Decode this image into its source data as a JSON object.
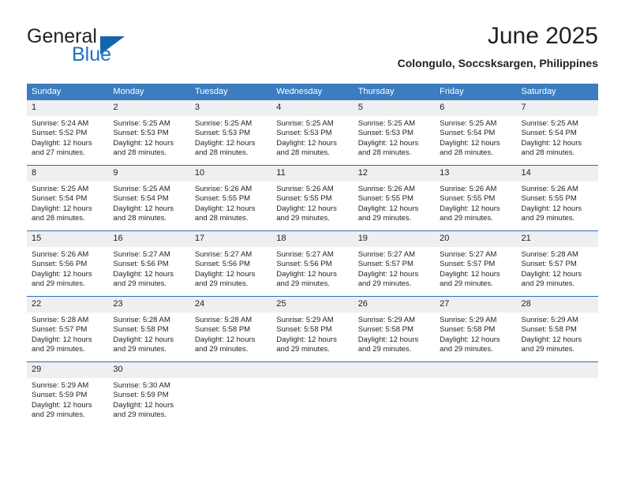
{
  "logo": {
    "word_one": "General",
    "word_two": "Blue",
    "triangle_color": "#1565ad",
    "blue_text_color": "#1e73be"
  },
  "header": {
    "title": "June 2025",
    "subtitle": "Colongulo, Soccsksargen, Philippines"
  },
  "theme": {
    "header_bg": "#3b7dc0",
    "header_text": "#ffffff",
    "daynum_bg": "#efefef",
    "row_border": "#2a6fb5",
    "body_text": "#231f20"
  },
  "weekday_headers": [
    "Sunday",
    "Monday",
    "Tuesday",
    "Wednesday",
    "Thursday",
    "Friday",
    "Saturday"
  ],
  "weeks": [
    [
      {
        "day": "1",
        "sunrise": "Sunrise: 5:24 AM",
        "sunset": "Sunset: 5:52 PM",
        "daylight_line1": "Daylight: 12 hours",
        "daylight_line2": "and 27 minutes."
      },
      {
        "day": "2",
        "sunrise": "Sunrise: 5:25 AM",
        "sunset": "Sunset: 5:53 PM",
        "daylight_line1": "Daylight: 12 hours",
        "daylight_line2": "and 28 minutes."
      },
      {
        "day": "3",
        "sunrise": "Sunrise: 5:25 AM",
        "sunset": "Sunset: 5:53 PM",
        "daylight_line1": "Daylight: 12 hours",
        "daylight_line2": "and 28 minutes."
      },
      {
        "day": "4",
        "sunrise": "Sunrise: 5:25 AM",
        "sunset": "Sunset: 5:53 PM",
        "daylight_line1": "Daylight: 12 hours",
        "daylight_line2": "and 28 minutes."
      },
      {
        "day": "5",
        "sunrise": "Sunrise: 5:25 AM",
        "sunset": "Sunset: 5:53 PM",
        "daylight_line1": "Daylight: 12 hours",
        "daylight_line2": "and 28 minutes."
      },
      {
        "day": "6",
        "sunrise": "Sunrise: 5:25 AM",
        "sunset": "Sunset: 5:54 PM",
        "daylight_line1": "Daylight: 12 hours",
        "daylight_line2": "and 28 minutes."
      },
      {
        "day": "7",
        "sunrise": "Sunrise: 5:25 AM",
        "sunset": "Sunset: 5:54 PM",
        "daylight_line1": "Daylight: 12 hours",
        "daylight_line2": "and 28 minutes."
      }
    ],
    [
      {
        "day": "8",
        "sunrise": "Sunrise: 5:25 AM",
        "sunset": "Sunset: 5:54 PM",
        "daylight_line1": "Daylight: 12 hours",
        "daylight_line2": "and 28 minutes."
      },
      {
        "day": "9",
        "sunrise": "Sunrise: 5:25 AM",
        "sunset": "Sunset: 5:54 PM",
        "daylight_line1": "Daylight: 12 hours",
        "daylight_line2": "and 28 minutes."
      },
      {
        "day": "10",
        "sunrise": "Sunrise: 5:26 AM",
        "sunset": "Sunset: 5:55 PM",
        "daylight_line1": "Daylight: 12 hours",
        "daylight_line2": "and 28 minutes."
      },
      {
        "day": "11",
        "sunrise": "Sunrise: 5:26 AM",
        "sunset": "Sunset: 5:55 PM",
        "daylight_line1": "Daylight: 12 hours",
        "daylight_line2": "and 29 minutes."
      },
      {
        "day": "12",
        "sunrise": "Sunrise: 5:26 AM",
        "sunset": "Sunset: 5:55 PM",
        "daylight_line1": "Daylight: 12 hours",
        "daylight_line2": "and 29 minutes."
      },
      {
        "day": "13",
        "sunrise": "Sunrise: 5:26 AM",
        "sunset": "Sunset: 5:55 PM",
        "daylight_line1": "Daylight: 12 hours",
        "daylight_line2": "and 29 minutes."
      },
      {
        "day": "14",
        "sunrise": "Sunrise: 5:26 AM",
        "sunset": "Sunset: 5:55 PM",
        "daylight_line1": "Daylight: 12 hours",
        "daylight_line2": "and 29 minutes."
      }
    ],
    [
      {
        "day": "15",
        "sunrise": "Sunrise: 5:26 AM",
        "sunset": "Sunset: 5:56 PM",
        "daylight_line1": "Daylight: 12 hours",
        "daylight_line2": "and 29 minutes."
      },
      {
        "day": "16",
        "sunrise": "Sunrise: 5:27 AM",
        "sunset": "Sunset: 5:56 PM",
        "daylight_line1": "Daylight: 12 hours",
        "daylight_line2": "and 29 minutes."
      },
      {
        "day": "17",
        "sunrise": "Sunrise: 5:27 AM",
        "sunset": "Sunset: 5:56 PM",
        "daylight_line1": "Daylight: 12 hours",
        "daylight_line2": "and 29 minutes."
      },
      {
        "day": "18",
        "sunrise": "Sunrise: 5:27 AM",
        "sunset": "Sunset: 5:56 PM",
        "daylight_line1": "Daylight: 12 hours",
        "daylight_line2": "and 29 minutes."
      },
      {
        "day": "19",
        "sunrise": "Sunrise: 5:27 AM",
        "sunset": "Sunset: 5:57 PM",
        "daylight_line1": "Daylight: 12 hours",
        "daylight_line2": "and 29 minutes."
      },
      {
        "day": "20",
        "sunrise": "Sunrise: 5:27 AM",
        "sunset": "Sunset: 5:57 PM",
        "daylight_line1": "Daylight: 12 hours",
        "daylight_line2": "and 29 minutes."
      },
      {
        "day": "21",
        "sunrise": "Sunrise: 5:28 AM",
        "sunset": "Sunset: 5:57 PM",
        "daylight_line1": "Daylight: 12 hours",
        "daylight_line2": "and 29 minutes."
      }
    ],
    [
      {
        "day": "22",
        "sunrise": "Sunrise: 5:28 AM",
        "sunset": "Sunset: 5:57 PM",
        "daylight_line1": "Daylight: 12 hours",
        "daylight_line2": "and 29 minutes."
      },
      {
        "day": "23",
        "sunrise": "Sunrise: 5:28 AM",
        "sunset": "Sunset: 5:58 PM",
        "daylight_line1": "Daylight: 12 hours",
        "daylight_line2": "and 29 minutes."
      },
      {
        "day": "24",
        "sunrise": "Sunrise: 5:28 AM",
        "sunset": "Sunset: 5:58 PM",
        "daylight_line1": "Daylight: 12 hours",
        "daylight_line2": "and 29 minutes."
      },
      {
        "day": "25",
        "sunrise": "Sunrise: 5:29 AM",
        "sunset": "Sunset: 5:58 PM",
        "daylight_line1": "Daylight: 12 hours",
        "daylight_line2": "and 29 minutes."
      },
      {
        "day": "26",
        "sunrise": "Sunrise: 5:29 AM",
        "sunset": "Sunset: 5:58 PM",
        "daylight_line1": "Daylight: 12 hours",
        "daylight_line2": "and 29 minutes."
      },
      {
        "day": "27",
        "sunrise": "Sunrise: 5:29 AM",
        "sunset": "Sunset: 5:58 PM",
        "daylight_line1": "Daylight: 12 hours",
        "daylight_line2": "and 29 minutes."
      },
      {
        "day": "28",
        "sunrise": "Sunrise: 5:29 AM",
        "sunset": "Sunset: 5:58 PM",
        "daylight_line1": "Daylight: 12 hours",
        "daylight_line2": "and 29 minutes."
      }
    ],
    [
      {
        "day": "29",
        "sunrise": "Sunrise: 5:29 AM",
        "sunset": "Sunset: 5:59 PM",
        "daylight_line1": "Daylight: 12 hours",
        "daylight_line2": "and 29 minutes."
      },
      {
        "day": "30",
        "sunrise": "Sunrise: 5:30 AM",
        "sunset": "Sunset: 5:59 PM",
        "daylight_line1": "Daylight: 12 hours",
        "daylight_line2": "and 29 minutes."
      },
      {
        "day": "",
        "sunrise": "",
        "sunset": "",
        "daylight_line1": "",
        "daylight_line2": ""
      },
      {
        "day": "",
        "sunrise": "",
        "sunset": "",
        "daylight_line1": "",
        "daylight_line2": ""
      },
      {
        "day": "",
        "sunrise": "",
        "sunset": "",
        "daylight_line1": "",
        "daylight_line2": ""
      },
      {
        "day": "",
        "sunrise": "",
        "sunset": "",
        "daylight_line1": "",
        "daylight_line2": ""
      },
      {
        "day": "",
        "sunrise": "",
        "sunset": "",
        "daylight_line1": "",
        "daylight_line2": ""
      }
    ]
  ]
}
